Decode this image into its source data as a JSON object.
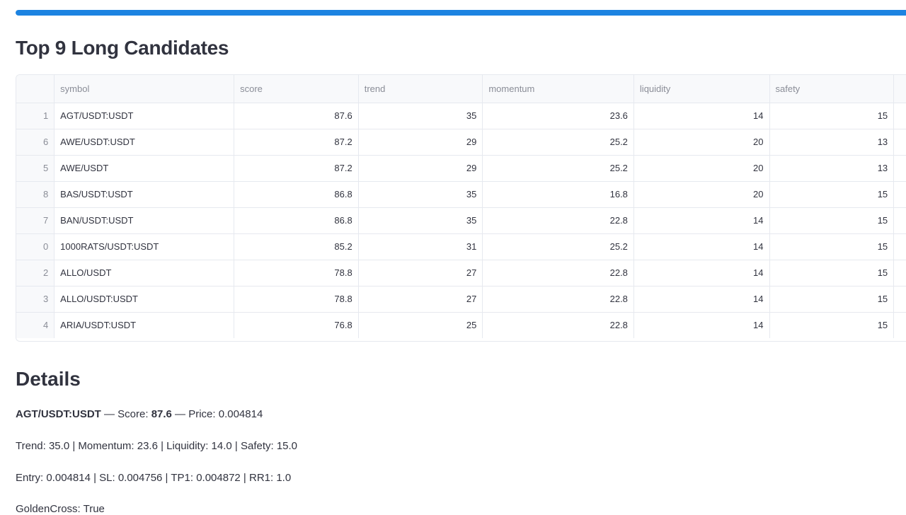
{
  "progress": {
    "value_percent": 100,
    "color": "#1c83e1"
  },
  "candidates_title": "Top 9 Long Candidates",
  "table": {
    "columns": [
      "symbol",
      "score",
      "trend",
      "momentum",
      "liquidity",
      "safety"
    ],
    "rows": [
      {
        "index": "1",
        "symbol": "AGT/USDT:USDT",
        "score": "87.6",
        "trend": "35",
        "momentum": "23.6",
        "liquidity": "14",
        "safety": "15"
      },
      {
        "index": "6",
        "symbol": "AWE/USDT:USDT",
        "score": "87.2",
        "trend": "29",
        "momentum": "25.2",
        "liquidity": "20",
        "safety": "13"
      },
      {
        "index": "5",
        "symbol": "AWE/USDT",
        "score": "87.2",
        "trend": "29",
        "momentum": "25.2",
        "liquidity": "20",
        "safety": "13"
      },
      {
        "index": "8",
        "symbol": "BAS/USDT:USDT",
        "score": "86.8",
        "trend": "35",
        "momentum": "16.8",
        "liquidity": "20",
        "safety": "15"
      },
      {
        "index": "7",
        "symbol": "BAN/USDT:USDT",
        "score": "86.8",
        "trend": "35",
        "momentum": "22.8",
        "liquidity": "14",
        "safety": "15"
      },
      {
        "index": "0",
        "symbol": "1000RATS/USDT:USDT",
        "score": "85.2",
        "trend": "31",
        "momentum": "25.2",
        "liquidity": "14",
        "safety": "15"
      },
      {
        "index": "2",
        "symbol": "ALLO/USDT",
        "score": "78.8",
        "trend": "27",
        "momentum": "22.8",
        "liquidity": "14",
        "safety": "15"
      },
      {
        "index": "3",
        "symbol": "ALLO/USDT:USDT",
        "score": "78.8",
        "trend": "27",
        "momentum": "22.8",
        "liquidity": "14",
        "safety": "15"
      },
      {
        "index": "4",
        "symbol": "ARIA/USDT:USDT",
        "score": "76.8",
        "trend": "25",
        "momentum": "22.8",
        "liquidity": "14",
        "safety": "15"
      }
    ]
  },
  "details": {
    "title": "Details",
    "symbol": "AGT/USDT:USDT",
    "sep1": " — Score: ",
    "score": "87.6",
    "price_text": " — Price: 0.004814",
    "metrics_line": "Trend: 35.0 | Momentum: 23.6 | Liquidity: 14.0 | Safety: 15.0",
    "levels_line": "Entry: 0.004814 | SL: 0.004756 | TP1: 0.004872 | RR1: 1.0",
    "golden_cross_line": "GoldenCross: True"
  }
}
